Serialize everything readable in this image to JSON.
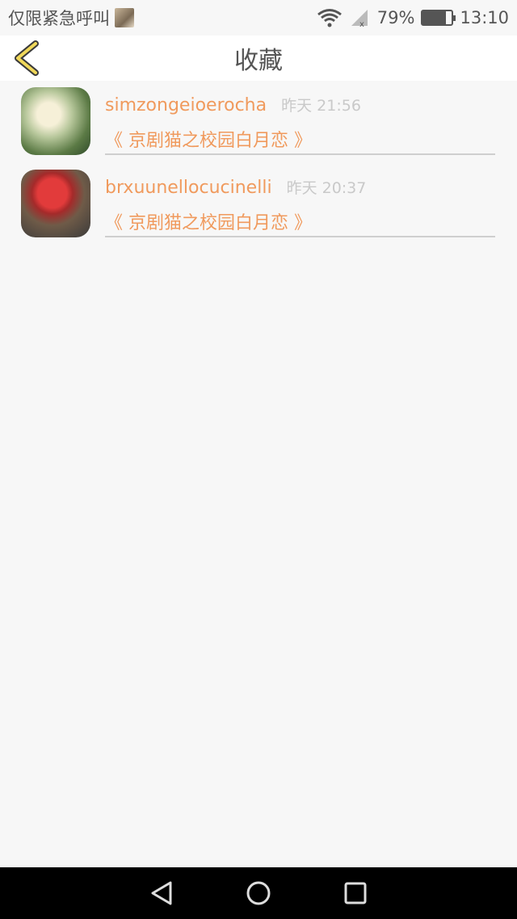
{
  "status_bar": {
    "carrier_text": "仅限紧急呼叫",
    "battery": "79%",
    "battery_level": 0.79,
    "time": "13:10",
    "icons": [
      "image-thumbnail-icon",
      "wifi-icon",
      "signal-icon",
      "battery-icon"
    ]
  },
  "header": {
    "title": "收藏",
    "back_icon": "chevron-left-icon",
    "accent_color": "#f0d85a"
  },
  "favorites": [
    {
      "username": "simzongeioerocha",
      "time": "昨天 21:56",
      "book": "《 京剧猫之校园白月恋 》"
    },
    {
      "username": "brxuunellocucinelli",
      "time": "昨天 20:37",
      "book": "《 京剧猫之校园白月恋 》"
    }
  ],
  "colors": {
    "name": "#f09a5d",
    "time": "#c9c9c9",
    "background": "#f7f7f7"
  },
  "nav_bar": {
    "buttons": [
      "back-triangle-icon",
      "home-circle-icon",
      "recents-square-icon"
    ]
  }
}
